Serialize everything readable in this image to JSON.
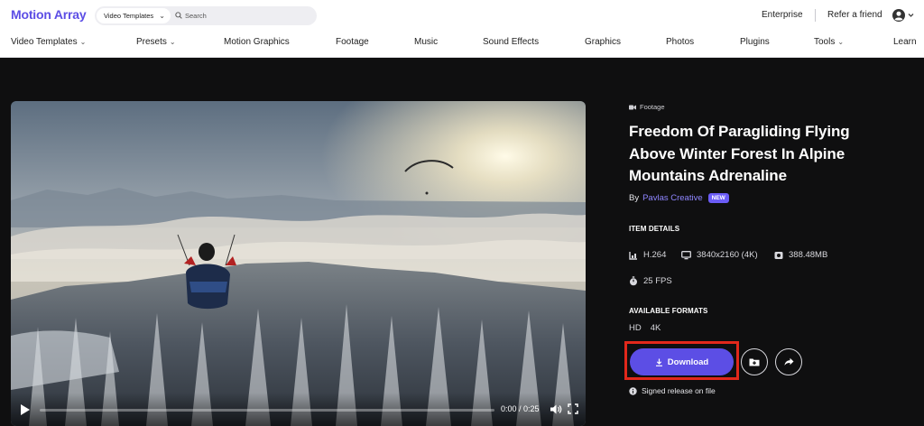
{
  "header": {
    "logo": "Motion Array",
    "search_category": "Video Templates",
    "search_placeholder": "Search",
    "enterprise": "Enterprise",
    "refer": "Refer a friend"
  },
  "nav": [
    {
      "label": "Video Templates",
      "has_dropdown": true
    },
    {
      "label": "Presets",
      "has_dropdown": true
    },
    {
      "label": "Motion Graphics",
      "has_dropdown": false
    },
    {
      "label": "Footage",
      "has_dropdown": false
    },
    {
      "label": "Music",
      "has_dropdown": false
    },
    {
      "label": "Sound Effects",
      "has_dropdown": false
    },
    {
      "label": "Graphics",
      "has_dropdown": false
    },
    {
      "label": "Photos",
      "has_dropdown": false
    },
    {
      "label": "Plugins",
      "has_dropdown": false
    },
    {
      "label": "Tools",
      "has_dropdown": true
    },
    {
      "label": "Learn",
      "has_dropdown": false
    }
  ],
  "player": {
    "time": "0:00 / 0:25",
    "progress": 0.0
  },
  "item": {
    "category": "Footage",
    "title": "Freedom Of Paragliding Flying Above Winter Forest In Alpine Mountains Adrenaline",
    "by_label": "By",
    "author": "Pavlas Creative",
    "badge": "NEW",
    "details_heading": "ITEM DETAILS",
    "codec": "H.264",
    "resolution": "3840x2160 (4K)",
    "size": "388.48MB",
    "fps": "25 FPS",
    "formats_heading": "AVAILABLE FORMATS",
    "formats": [
      "HD",
      "4K"
    ],
    "download_label": "Download",
    "signed_release": "Signed release on file"
  },
  "colors": {
    "brand": "#5c4ee5",
    "author_link": "#8f86ff",
    "highlight": "#e2281b",
    "background": "#0f0f10"
  },
  "icons": [
    "search-icon",
    "chevron-down-icon",
    "account-icon",
    "play-icon",
    "volume-icon",
    "fullscreen-icon",
    "video-camera-icon",
    "codec-icon",
    "monitor-icon",
    "storage-icon",
    "stopwatch-icon",
    "download-icon",
    "add-to-folder-icon",
    "share-icon",
    "info-icon"
  ]
}
